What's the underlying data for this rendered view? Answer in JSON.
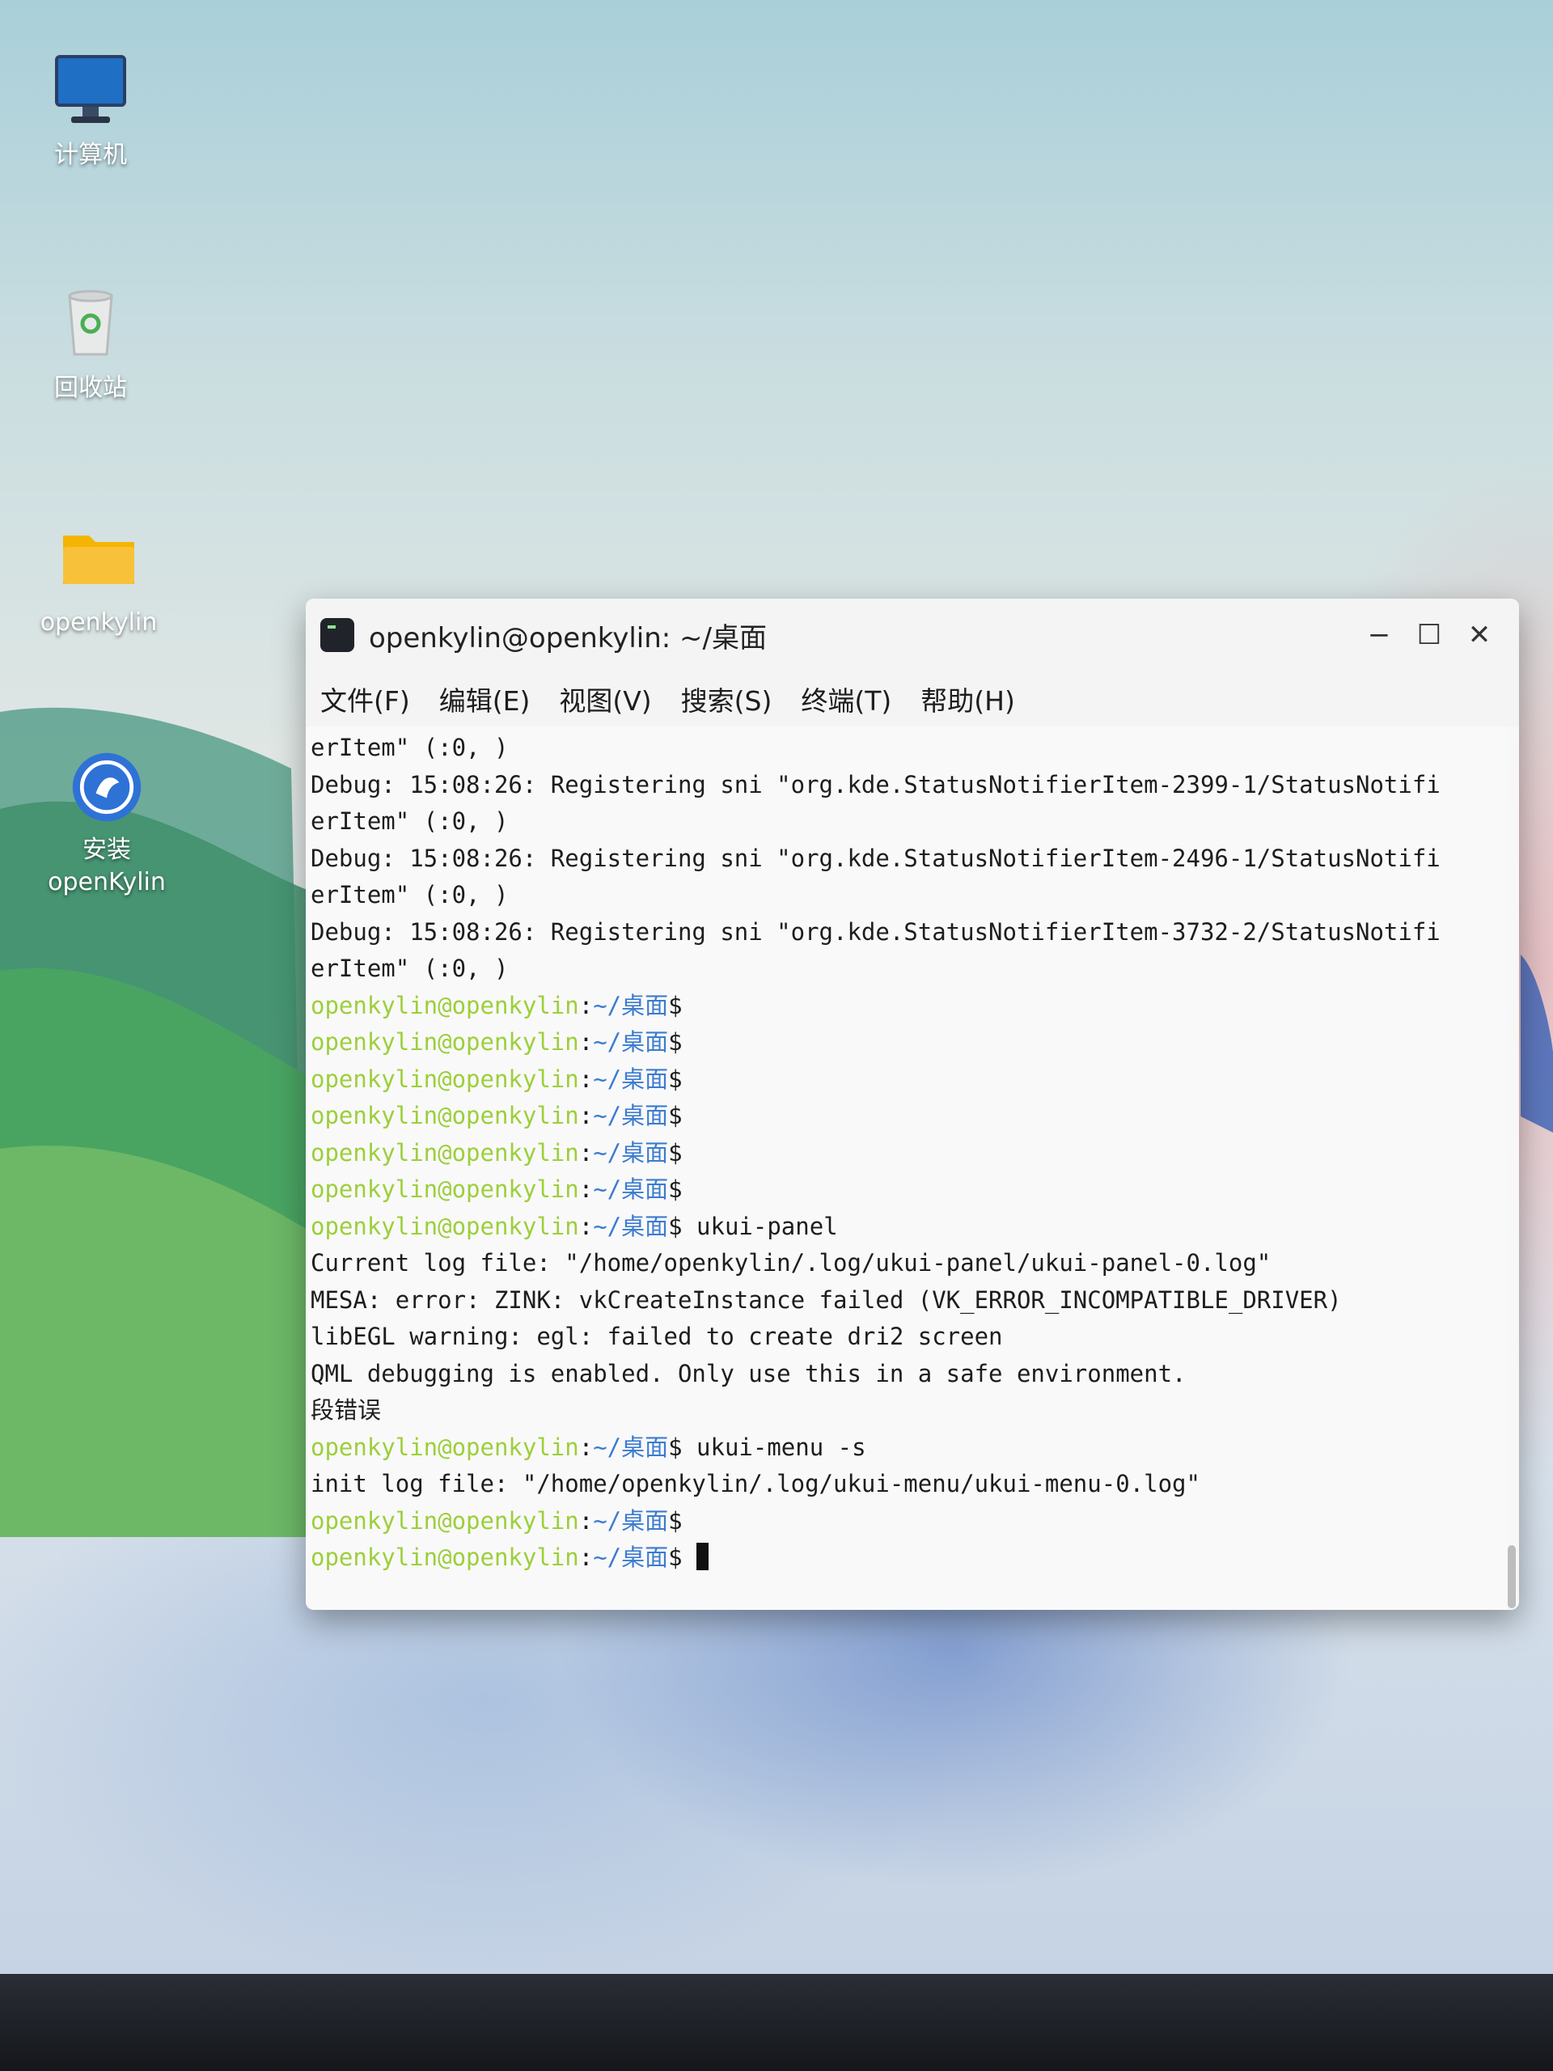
{
  "desktop": {
    "icons": [
      {
        "label": "计算机",
        "icon": "monitor-icon"
      },
      {
        "label": "回收站",
        "icon": "trash-icon"
      },
      {
        "label": "openkylin",
        "icon": "folder-icon"
      },
      {
        "label": "安装",
        "label2": "openKylin",
        "icon": "installer-icon"
      }
    ]
  },
  "terminal": {
    "title": "openkylin@openkylin: ~/桌面",
    "controls": {
      "minimize": "−",
      "maximize": "☐",
      "close": "✕"
    },
    "menu": [
      "文件(F)",
      "编辑(E)",
      "视图(V)",
      "搜索(S)",
      "终端(T)",
      "帮助(H)"
    ],
    "prompt": {
      "user": "openkylin@openkylin",
      "sep": ":",
      "path": "~/桌面",
      "symbol": "$"
    },
    "lines": [
      {
        "text": "erItem\" (:0, )"
      },
      {
        "text": "Debug: 15:08:26: Registering sni \"org.kde.StatusNotifierItem-2399-1/StatusNotifi"
      },
      {
        "text": "erItem\" (:0, )"
      },
      {
        "text": "Debug: 15:08:26: Registering sni \"org.kde.StatusNotifierItem-2496-1/StatusNotifi"
      },
      {
        "text": "erItem\" (:0, )"
      },
      {
        "text": "Debug: 15:08:26: Registering sni \"org.kde.StatusNotifierItem-3732-2/StatusNotifi"
      },
      {
        "text": "erItem\" (:0, )"
      },
      {
        "cmd": ""
      },
      {
        "cmd": ""
      },
      {
        "cmd": ""
      },
      {
        "cmd": ""
      },
      {
        "cmd": ""
      },
      {
        "cmd": ""
      },
      {
        "cmd": " ukui-panel"
      },
      {
        "text": "Current log file: \"/home/openkylin/.log/ukui-panel/ukui-panel-0.log\""
      },
      {
        "text": "MESA: error: ZINK: vkCreateInstance failed (VK_ERROR_INCOMPATIBLE_DRIVER)"
      },
      {
        "text": "libEGL warning: egl: failed to create dri2 screen"
      },
      {
        "text": "QML debugging is enabled. Only use this in a safe environment."
      },
      {
        "text": "段错误"
      },
      {
        "cmd": " ukui-menu -s"
      },
      {
        "text": "init log file: \"/home/openkylin/.log/ukui-menu/ukui-menu-0.log\""
      },
      {
        "cmd": ""
      },
      {
        "cmd": " ",
        "cursor": true
      }
    ]
  }
}
